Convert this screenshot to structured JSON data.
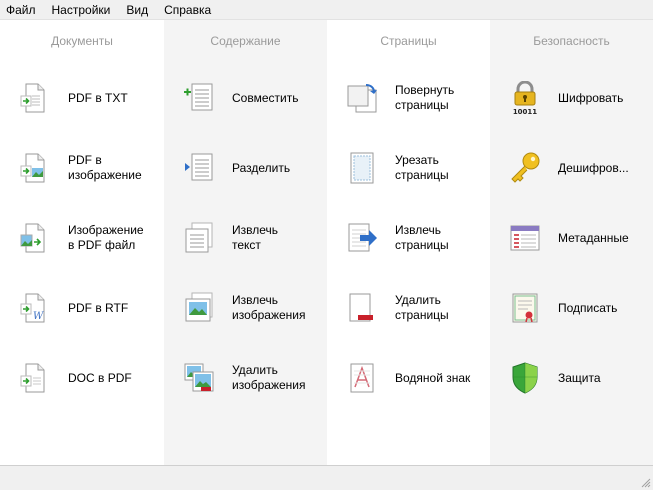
{
  "menu": [
    "Файл",
    "Настройки",
    "Вид",
    "Справка"
  ],
  "columns": [
    {
      "header": "Документы",
      "tools": [
        {
          "label": "PDF в TXT",
          "icon": "pdf-to-txt-icon"
        },
        {
          "label": "PDF в\nизображение",
          "icon": "pdf-to-image-icon"
        },
        {
          "label": "Изображение\nв PDF файл",
          "icon": "image-to-pdf-icon"
        },
        {
          "label": "PDF в RTF",
          "icon": "pdf-to-rtf-icon"
        },
        {
          "label": "DOC в PDF",
          "icon": "doc-to-pdf-icon"
        }
      ]
    },
    {
      "header": "Содержание",
      "tools": [
        {
          "label": "Совместить",
          "icon": "merge-icon"
        },
        {
          "label": "Разделить",
          "icon": "split-icon"
        },
        {
          "label": "Извлечь\nтекст",
          "icon": "extract-text-icon"
        },
        {
          "label": "Извлечь\nизображения",
          "icon": "extract-images-icon"
        },
        {
          "label": "Удалить\nизображения",
          "icon": "delete-images-icon"
        }
      ]
    },
    {
      "header": "Страницы",
      "tools": [
        {
          "label": "Повернуть\nстраницы",
          "icon": "rotate-pages-icon"
        },
        {
          "label": "Урезать\nстраницы",
          "icon": "crop-pages-icon"
        },
        {
          "label": "Извлечь\nстраницы",
          "icon": "extract-pages-icon"
        },
        {
          "label": "Удалить\nстраницы",
          "icon": "delete-pages-icon"
        },
        {
          "label": "Водяной знак",
          "icon": "watermark-icon"
        }
      ]
    },
    {
      "header": "Безопасность",
      "tools": [
        {
          "label": "Шифровать",
          "icon": "lock-icon"
        },
        {
          "label": "Дешифров...",
          "icon": "key-icon"
        },
        {
          "label": "Метаданные",
          "icon": "metadata-icon"
        },
        {
          "label": "Подписать",
          "icon": "certificate-icon"
        },
        {
          "label": "Защита",
          "icon": "shield-icon"
        }
      ]
    }
  ],
  "lock_icon_text": "10011",
  "colors": {
    "header_text": "#9a9a9a",
    "alt_column": "#f4f4f4",
    "menubar": "#f0f0f0"
  }
}
